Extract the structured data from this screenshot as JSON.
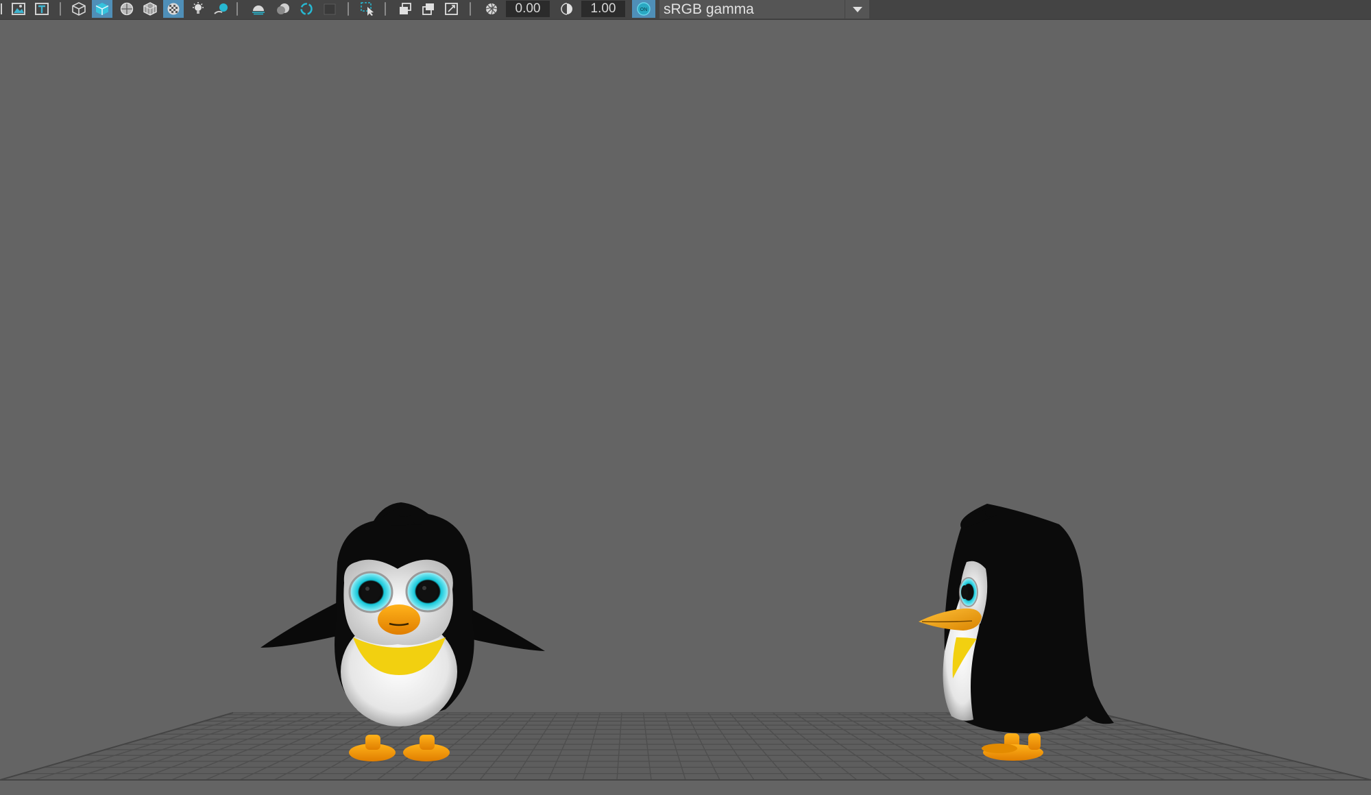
{
  "toolbar": {
    "exposure_value": "0.00",
    "gamma_value": "1.00",
    "color_management_badge": "ON",
    "color_space": "sRGB gamma",
    "icons": [
      "image-plane-icon",
      "text-icon",
      "wireframe-cube-icon",
      "smooth-shade-cube-icon",
      "default-material-icon",
      "wireframe-on-shaded-icon",
      "xray-icon",
      "use-lights-icon",
      "shadows-icon",
      "screen-space-ao-icon",
      "motion-blur-icon",
      "anti-aliasing-icon",
      "depth-of-field-icon",
      "isolate-select-icon",
      "xray-joints-icon",
      "xray-active-icon",
      "gate-mask-icon",
      "exposure-icon",
      "gamma-icon",
      "color-management-icon",
      "dropdown-arrow-icon"
    ],
    "accent_color": "#4f8fb8",
    "teal_color": "#1fb7c9"
  },
  "viewport": {
    "background_color": "#646464",
    "grid_color": "#4d4d4d",
    "objects": [
      "penguin-front",
      "penguin-side"
    ]
  }
}
